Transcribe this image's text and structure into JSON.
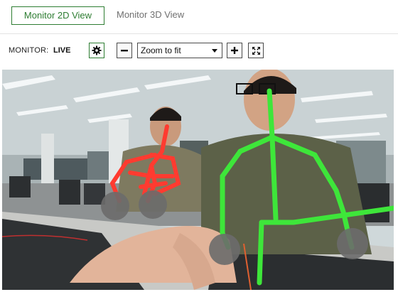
{
  "tabs": [
    {
      "label": "Monitor 2D View",
      "active": true
    },
    {
      "label": "Monitor 3D View",
      "active": false
    }
  ],
  "toolbar": {
    "monitor_label": "MONITOR:",
    "monitor_status": "LIVE",
    "settings_icon": "gear-icon",
    "zoom_out_icon": "minus-icon",
    "zoom_value": "Zoom to fit",
    "zoom_in_icon": "plus-icon",
    "fullscreen_icon": "expand-icon"
  },
  "colors": {
    "accent": "#2e7d32",
    "skeleton_near": "#3ee63a",
    "skeleton_far": "#ff3b30",
    "joint_marker": "#6b6b6b"
  }
}
